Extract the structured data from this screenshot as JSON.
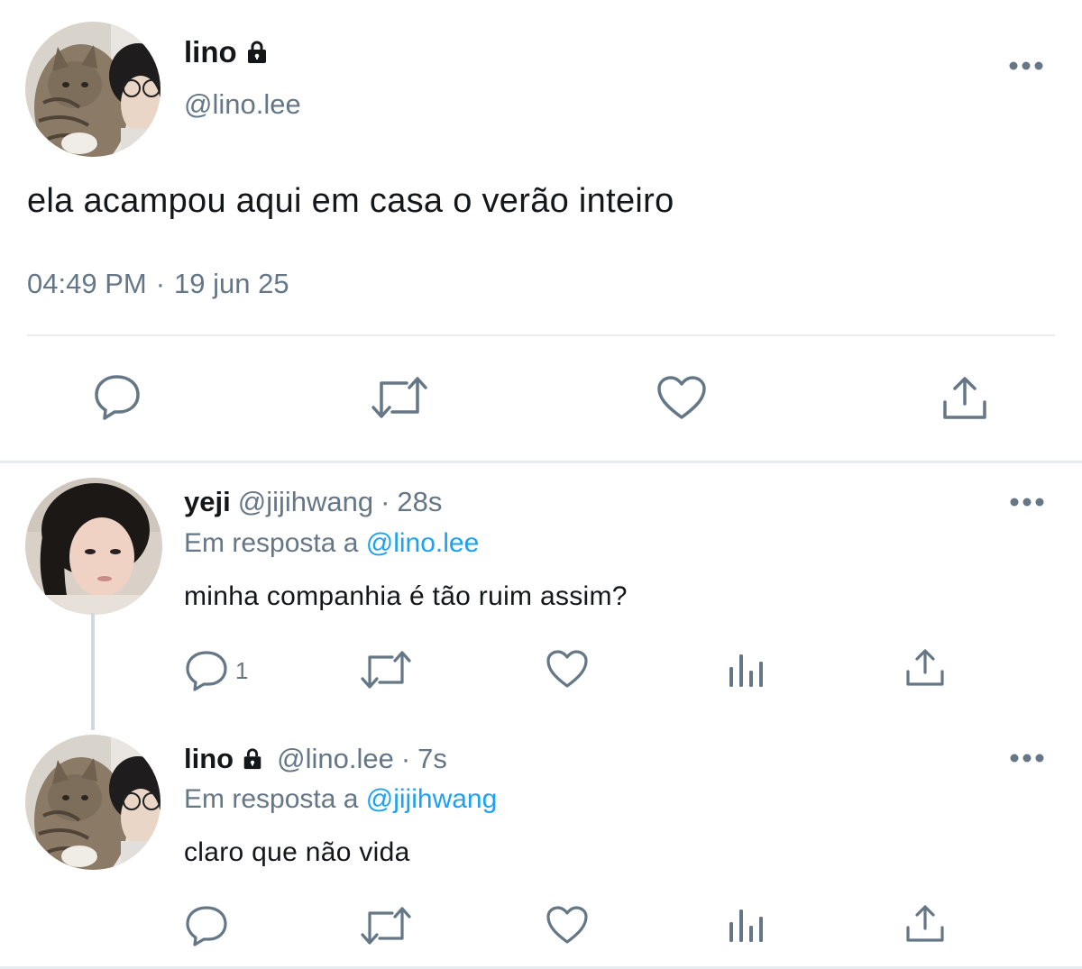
{
  "main_tweet": {
    "name": "lino",
    "handle": "@lino.lee",
    "text": "ela acampou aqui em casa o verão inteiro",
    "time": "04:49 PM",
    "separator": "·",
    "date": "19 jun 25",
    "actions": [
      "reply-icon",
      "retweet-icon",
      "like-icon",
      "share-icon"
    ]
  },
  "replies": [
    {
      "name": "yeji",
      "handle": "@jijihwang",
      "separator": "·",
      "time": "28s",
      "reply_to_label": "Em resposta a",
      "reply_to_handle": "@lino.lee",
      "text": "minha companhia é tão ruim assim?",
      "reply_count": "1"
    },
    {
      "name": "lino",
      "handle": "@lino.lee",
      "separator": "·",
      "time": "7s",
      "reply_to_label": "Em resposta a",
      "reply_to_handle": "@jijihwang",
      "text": "claro que não vida",
      "reply_count": ""
    }
  ],
  "colors": {
    "text": "#14171a",
    "secondary": "#657786",
    "mention": "#1da1f2",
    "divider": "#e6ecf0"
  }
}
